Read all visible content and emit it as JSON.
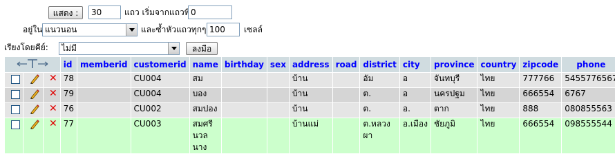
{
  "controls": {
    "show_button": "แสดง :",
    "rows_value": "30",
    "rows_label": "แถว เริ่มจากแถวที่",
    "start_row_value": "0",
    "mode_label": "อยู่ใน",
    "mode_value": "แนวนอน",
    "repeat_label": "และซ้ำหัวแถวทุกๆ",
    "repeat_value": "100",
    "cells_label": "เซลล์",
    "sort_label": "เรียงโดยคีย์:",
    "sort_value": "ไม่มี",
    "go_button": "ลงมือ"
  },
  "table": {
    "columns": [
      "id",
      "memberid",
      "customerid",
      "name",
      "birthday",
      "sex",
      "address",
      "road",
      "district",
      "city",
      "province",
      "country",
      "zipcode",
      "phone"
    ],
    "rows": [
      {
        "id": "78",
        "memberid": "",
        "customerid": "CU004",
        "name": "สม",
        "birthday": "",
        "sex": "",
        "address": "บ้าน",
        "road": "",
        "district": "อัม",
        "city": "อ",
        "province": "จันทบุรี",
        "country": "ไทย",
        "zipcode": "777766",
        "phone": "5455776567"
      },
      {
        "id": "79",
        "memberid": "",
        "customerid": "CU004",
        "name": "บอง",
        "birthday": "",
        "sex": "",
        "address": "บ้าน",
        "road": "",
        "district": "ต.",
        "city": "อ",
        "province": "นครปฐม",
        "country": "ไทย",
        "zipcode": "666554",
        "phone": "6767"
      },
      {
        "id": "76",
        "memberid": "",
        "customerid": "CU002",
        "name": "สมปอง",
        "birthday": "",
        "sex": "",
        "address": "บ้าน",
        "road": "",
        "district": "ต.",
        "city": "อ.",
        "province": "ตาก",
        "country": "ไทย",
        "zipcode": "888",
        "phone": "080855563"
      },
      {
        "id": "77",
        "memberid": "",
        "customerid": "CU003",
        "name": "สมศรี\nนวล\nนาง",
        "birthday": "",
        "sex": "",
        "address": "บ้านแม่",
        "road": "",
        "district": "ต.หลวง\nผา",
        "city": "อ.เมือง",
        "province": "ชัยภูมิ",
        "country": "ไทย",
        "zipcode": "666554",
        "phone": "098555544"
      }
    ]
  },
  "colors": {
    "header_bg": "#d0dce0",
    "header_text": "#0000ff",
    "row_odd": "#e5e5e5",
    "row_even": "#d5d5d5",
    "row_marked": "#ccffcc",
    "delete_icon": "#e00000"
  }
}
